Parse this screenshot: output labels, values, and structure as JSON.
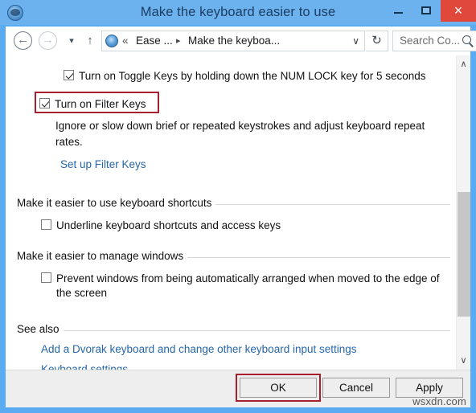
{
  "window": {
    "title": "Make the keyboard easier to use",
    "app_icon": "ease-of-access-icon",
    "controls": {
      "minimize": "–",
      "maximize": "□",
      "close": "×"
    },
    "titlebar_color": "#6cb2ee",
    "close_color": "#e0483b"
  },
  "nav": {
    "back": "←",
    "forward": "→",
    "recent": "▾",
    "up": "↑",
    "refresh": "↻",
    "address": {
      "icon": "ease-of-access-icon",
      "separator_first": "«",
      "crumb1": "Ease ...",
      "separator": "▸",
      "crumb2": "Make the keyboa...",
      "chevron": "∨"
    },
    "search": {
      "placeholder": "Search Co...",
      "value": "Search Co...",
      "icon": "search-icon"
    }
  },
  "content": {
    "toggle_keys": {
      "label": "Turn on Toggle Keys by holding down the NUM LOCK key for 5 seconds",
      "checked": true
    },
    "filter_keys": {
      "label": "Turn on Filter Keys",
      "checked": true,
      "highlighted": true,
      "highlight_color": "#a81f2d"
    },
    "filter_keys_description": "Ignore or slow down brief or repeated keystrokes and adjust keyboard repeat rates.",
    "setup_filter_keys_link": "Set up Filter Keys",
    "section_shortcuts": {
      "heading": "Make it easier to use keyboard shortcuts",
      "underline_shortcuts": {
        "label": "Underline keyboard shortcuts and access keys",
        "checked": false
      }
    },
    "section_windows": {
      "heading": "Make it easier to manage windows",
      "prevent_arrange": {
        "label": "Prevent windows from being automatically arranged when moved to the edge of the screen",
        "checked": false
      }
    },
    "section_see_also": {
      "heading": "See also",
      "links": [
        "Add a Dvorak keyboard and change other keyboard input settings",
        "Keyboard settings"
      ]
    },
    "scrollbar": {
      "up_arrow": "∧",
      "down_arrow": "∨"
    }
  },
  "footer": {
    "ok": "OK",
    "cancel": "Cancel",
    "apply": "Apply",
    "ok_highlighted": true,
    "highlight_color": "#a81f2d"
  },
  "watermark": "wsxdn.com"
}
